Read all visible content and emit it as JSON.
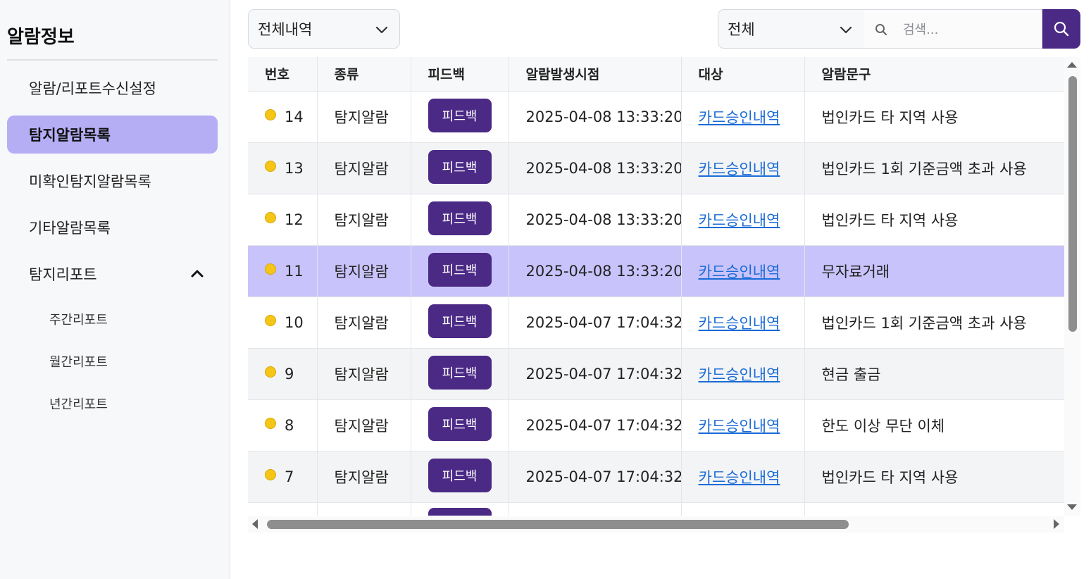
{
  "sidebar": {
    "title": "알람정보",
    "items": [
      {
        "label": "알람/리포트수신설정",
        "active": false
      },
      {
        "label": "탐지알람목록",
        "active": true
      },
      {
        "label": "미확인탐지알람목록",
        "active": false
      },
      {
        "label": "기타알람목록",
        "active": false
      },
      {
        "label": "탐지리포트",
        "active": false,
        "expanded": true
      }
    ],
    "subitems": [
      {
        "label": "주간리포트"
      },
      {
        "label": "월간리포트"
      },
      {
        "label": "년간리포트"
      }
    ]
  },
  "toolbar": {
    "history_select": "전체내역",
    "filter_select": "전체",
    "search_placeholder": "검색..."
  },
  "table": {
    "headers": [
      "번호",
      "종류",
      "피드백",
      "알람발생시점",
      "대상",
      "알람문구"
    ],
    "selected_row": 11,
    "rows": [
      {
        "no": "14",
        "type": "탐지알람",
        "feedback": "피드백",
        "time": "2025-04-08 13:33:20",
        "target": "카드승인내역",
        "message": "법인카드 타 지역 사용"
      },
      {
        "no": "13",
        "type": "탐지알람",
        "feedback": "피드백",
        "time": "2025-04-08 13:33:20",
        "target": "카드승인내역",
        "message": "법인카드 1회 기준금액 초과 사용"
      },
      {
        "no": "12",
        "type": "탐지알람",
        "feedback": "피드백",
        "time": "2025-04-08 13:33:20",
        "target": "카드승인내역",
        "message": "법인카드 타 지역 사용"
      },
      {
        "no": "11",
        "type": "탐지알람",
        "feedback": "피드백",
        "time": "2025-04-08 13:33:20",
        "target": "카드승인내역",
        "message": "무자료거래"
      },
      {
        "no": "10",
        "type": "탐지알람",
        "feedback": "피드백",
        "time": "2025-04-07 17:04:32",
        "target": "카드승인내역",
        "message": "법인카드 1회 기준금액 초과 사용"
      },
      {
        "no": "9",
        "type": "탐지알람",
        "feedback": "피드백",
        "time": "2025-04-07 17:04:32",
        "target": "카드승인내역",
        "message": "현금 출금"
      },
      {
        "no": "8",
        "type": "탐지알람",
        "feedback": "피드백",
        "time": "2025-04-07 17:04:32",
        "target": "카드승인내역",
        "message": "한도 이상 무단 이체"
      },
      {
        "no": "7",
        "type": "탐지알람",
        "feedback": "피드백",
        "time": "2025-04-07 17:04:32",
        "target": "카드승인내역",
        "message": "법인카드 타 지역 사용"
      }
    ]
  },
  "colors": {
    "accent": "#4b2a86",
    "active_nav": "#b5aef5",
    "selected_row": "#c9c3fb",
    "status_dot": "#f5c518",
    "link": "#1a6bd6"
  }
}
